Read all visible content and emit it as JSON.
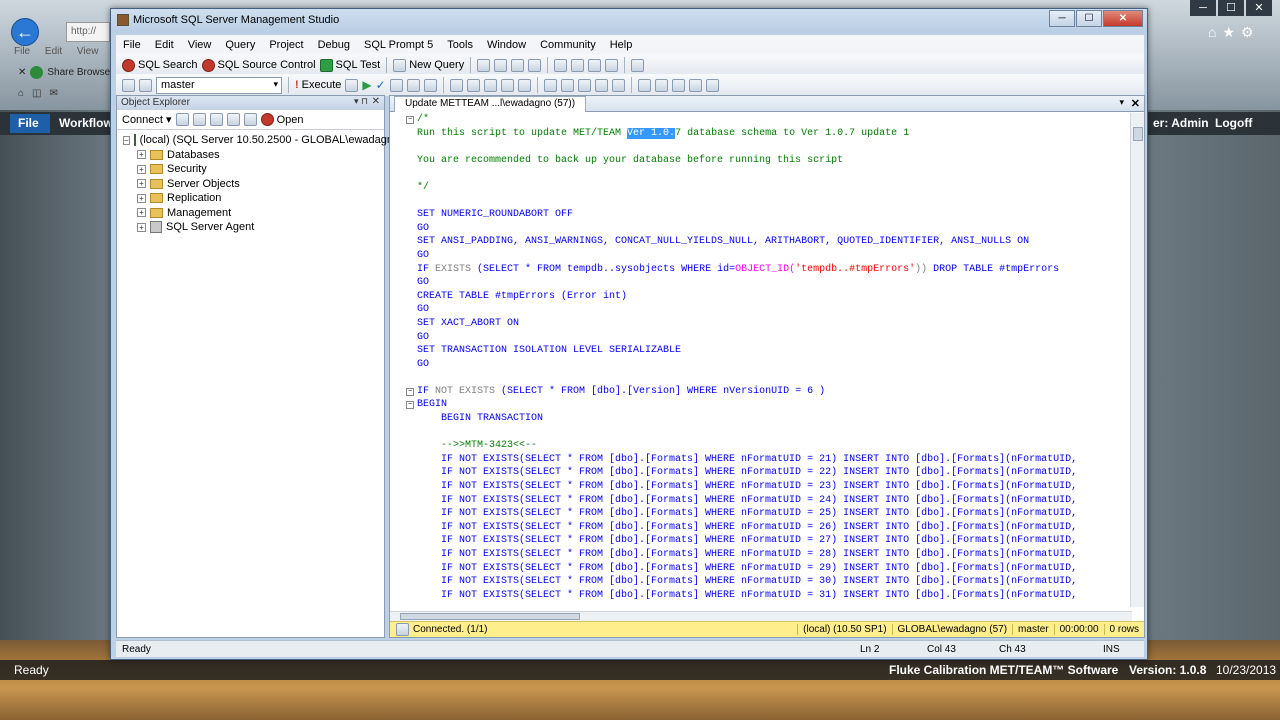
{
  "browser": {
    "tab_text": "http://",
    "left_links": [
      "File",
      "Edit",
      "View"
    ],
    "share_label": "Share Browser",
    "controls": [
      "─",
      "☐",
      "✕"
    ]
  },
  "metteam": {
    "file_label": "File",
    "workflow_label": "Workflow",
    "user_label": "er: Admin",
    "logoff_label": "Logoff",
    "status_ready": "Ready",
    "brand": "Fluke Calibration MET/TEAM™ Software",
    "version": "Version: 1.0.8",
    "date": "10/23/2013"
  },
  "ssms": {
    "title": "Microsoft SQL Server Management Studio",
    "menu": [
      "File",
      "Edit",
      "View",
      "Query",
      "Project",
      "Debug",
      "SQL Prompt 5",
      "Tools",
      "Window",
      "Community",
      "Help"
    ],
    "toolbar1": {
      "sql_search": "SQL Search",
      "source_control": "SQL Source Control",
      "sql_test": "SQL Test",
      "new_query": "New Query"
    },
    "toolbar2": {
      "database": "master",
      "execute": "Execute"
    },
    "object_explorer": {
      "title": "Object Explorer",
      "connect": "Connect ▾",
      "open": "Open",
      "server": "(local) (SQL Server 10.50.2500 - GLOBAL\\ewadagno)",
      "nodes": [
        "Databases",
        "Security",
        "Server Objects",
        "Replication",
        "Management",
        "SQL Server Agent"
      ]
    },
    "editor": {
      "tab": "Update METTEAM ...l\\ewadagno (57))",
      "code": {
        "l1": "/*",
        "l2a": "Run this script to update MET/TEAM ",
        "l2b": "Ver 1.0.",
        "l2c": "7 database schema to Ver 1.0.7 update 1",
        "l4": "You are recommended to back up your database before running this script",
        "l6": "*/",
        "l8a": "SET NUMERIC_ROUNDABORT OFF",
        "go": "GO",
        "l10": "SET ANSI_PADDING, ANSI_WARNINGS, CONCAT_NULL_YIELDS_NULL, ARITHABORT, QUOTED_IDENTIFIER, ANSI_NULLS ON",
        "l12a": "IF",
        "l12b": " EXISTS ",
        "l12c": "(SELECT * FROM tempdb..sysobjects WHERE id=",
        "l12d": "OBJECT_ID(",
        "l12e": "'tempdb..#tmpErrors'",
        "l12f": "))",
        "l12g": " DROP TABLE #tmpErrors",
        "l14": "CREATE TABLE #tmpErrors (Error int)",
        "l16": "SET XACT_ABORT ON",
        "l18": "SET TRANSACTION ISOLATION LEVEL SERIALIZABLE",
        "l21a": "IF",
        "l21b": " NOT EXISTS ",
        "l21c": "(SELECT * FROM [dbo].[Version] WHERE nVersionUID = 6 )",
        "l22": "BEGIN",
        "l23": "    BEGIN TRANSACTION",
        "l25": "    -->>MTM-3423<<--"
      },
      "insert_rows": [
        "21",
        "22",
        "23",
        "24",
        "25",
        "26",
        "27",
        "28",
        "29",
        "30",
        "31"
      ],
      "insert_prefix": "    IF NOT EXISTS(SELECT * FROM [dbo].[Formats] WHERE nFormatUID = ",
      "insert_suffix": ") INSERT INTO [dbo].[Formats](nFormatUID,"
    },
    "query_status": {
      "connected": "Connected. (1/1)",
      "server": "(local) (10.50 SP1)",
      "user": "GLOBAL\\ewadagno (57)",
      "db": "master",
      "time": "00:00:00",
      "rows": "0 rows"
    },
    "status": {
      "ready": "Ready",
      "ln": "Ln 2",
      "col": "Col 43",
      "ch": "Ch 43",
      "ins": "INS"
    }
  }
}
